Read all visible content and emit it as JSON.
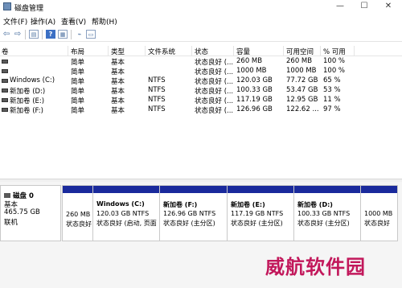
{
  "window": {
    "title": "磁盘管理",
    "minimize": "—",
    "maximize": "☐",
    "close": "✕"
  },
  "menu": [
    "文件(F)",
    "操作(A)",
    "查看(V)",
    "帮助(H)"
  ],
  "toolbar": {
    "icons": [
      "back-arrow",
      "forward-arrow",
      "console-tree",
      "help",
      "properties",
      "connect",
      "list-view"
    ]
  },
  "table": {
    "headers": [
      "卷",
      "布局",
      "类型",
      "文件系统",
      "状态",
      "容量",
      "可用空间",
      "% 可用"
    ],
    "rows": [
      {
        "vol": "",
        "layout": "简单",
        "type": "基本",
        "fs": "",
        "status": "状态良好 (...",
        "capacity": "260 MB",
        "free": "260 MB",
        "pct": "100 %"
      },
      {
        "vol": "",
        "layout": "简单",
        "type": "基本",
        "fs": "",
        "status": "状态良好 (...",
        "capacity": "1000 MB",
        "free": "1000 MB",
        "pct": "100 %"
      },
      {
        "vol": "Windows (C:)",
        "layout": "简单",
        "type": "基本",
        "fs": "NTFS",
        "status": "状态良好 (...",
        "capacity": "120.03 GB",
        "free": "77.72 GB",
        "pct": "65 %"
      },
      {
        "vol": "新加卷 (D:)",
        "layout": "简单",
        "type": "基本",
        "fs": "NTFS",
        "status": "状态良好 (...",
        "capacity": "100.33 GB",
        "free": "53.47 GB",
        "pct": "53 %"
      },
      {
        "vol": "新加卷 (E:)",
        "layout": "简单",
        "type": "基本",
        "fs": "NTFS",
        "status": "状态良好 (...",
        "capacity": "117.19 GB",
        "free": "12.95 GB",
        "pct": "11 %"
      },
      {
        "vol": "新加卷 (F:)",
        "layout": "简单",
        "type": "基本",
        "fs": "NTFS",
        "status": "状态良好 (...",
        "capacity": "126.96 GB",
        "free": "122.62 ...",
        "pct": "97 %"
      }
    ]
  },
  "disk": {
    "name": "磁盘 0",
    "type": "基本",
    "size": "465.75 GB",
    "status": "联机",
    "partitions": [
      {
        "name": "",
        "size": "260 MB",
        "status": "状态良好"
      },
      {
        "name": "Windows  (C:)",
        "size": "120.03 GB NTFS",
        "status": "状态良好 (启动, 页面"
      },
      {
        "name": "新加卷  (F:)",
        "size": "126.96 GB NTFS",
        "status": "状态良好 (主分区)"
      },
      {
        "name": "新加卷  (E:)",
        "size": "117.19 GB NTFS",
        "status": "状态良好 (主分区)"
      },
      {
        "name": "新加卷  (D:)",
        "size": "100.33 GB NTFS",
        "status": "状态良好 (主分区)"
      },
      {
        "name": "",
        "size": "1000 MB",
        "status": "状态良好"
      }
    ]
  },
  "watermark": "威航软件园"
}
